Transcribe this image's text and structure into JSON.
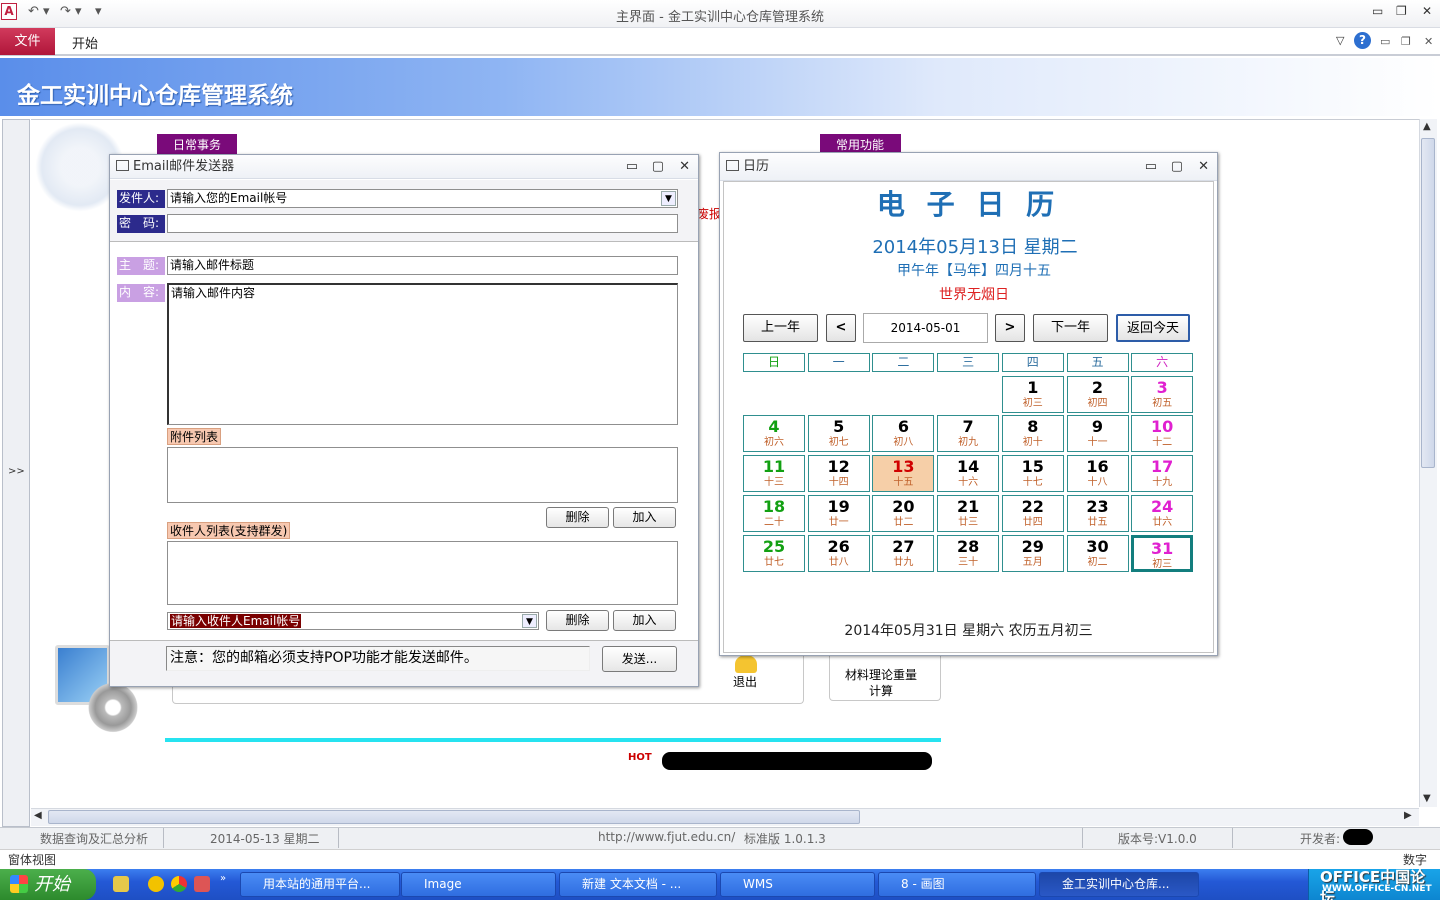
{
  "window": {
    "title": "主界面 - 金工实训中心仓库管理系统",
    "app_icon": "A"
  },
  "ribbon": {
    "file_tab": "文件",
    "home_tab": "开始"
  },
  "header": {
    "title": "金工实训中心仓库管理系统"
  },
  "nav": {
    "toggle": ">>"
  },
  "background_form": {
    "tab_daily": "日常事务",
    "tab_common": "常用功能",
    "partial_text": "废报",
    "exit_label": "退出",
    "material_label_1": "材料理论重量",
    "material_label_2": "计算",
    "hot_badge": "HOT"
  },
  "email": {
    "title": "Email邮件发送器",
    "sender_label": "发件人:",
    "sender_value": "请输入您的Email帐号",
    "password_label": "密　码:",
    "subject_label": "主　题:",
    "subject_value": "请输入邮件标题",
    "content_label": "内　容:",
    "content_value": "请输入邮件内容",
    "attachments_label": "附件列表",
    "delete_label": "删除",
    "add_label": "加入",
    "recipients_label": "收件人列表(支持群发)",
    "recipient_input": "请输入收件人Email帐号",
    "note": "注意：您的邮箱必须支持POP功能才能发送邮件。",
    "send_label": "发送..."
  },
  "calendar": {
    "title": "日历",
    "heading": "电 子 日 历",
    "date_full": "2014年05月13日  星期二",
    "lunar": "甲午年【马年】四月十五",
    "festival": "世界无烟日",
    "prev_year": "上一年",
    "prev_month": "<",
    "date_value": "2014-05-01",
    "next_month": ">",
    "next_year": "下一年",
    "back_today": "返回今天",
    "weekdays": [
      "日",
      "一",
      "二",
      "三",
      "四",
      "五",
      "六"
    ],
    "days": [
      {
        "d": "1",
        "l": "初三"
      },
      {
        "d": "2",
        "l": "初四"
      },
      {
        "d": "3",
        "l": "初五"
      },
      {
        "d": "4",
        "l": "初六"
      },
      {
        "d": "5",
        "l": "初七"
      },
      {
        "d": "6",
        "l": "初八"
      },
      {
        "d": "7",
        "l": "初九"
      },
      {
        "d": "8",
        "l": "初十"
      },
      {
        "d": "9",
        "l": "十一"
      },
      {
        "d": "10",
        "l": "十二"
      },
      {
        "d": "11",
        "l": "十三"
      },
      {
        "d": "12",
        "l": "十四"
      },
      {
        "d": "13",
        "l": "十五"
      },
      {
        "d": "14",
        "l": "十六"
      },
      {
        "d": "15",
        "l": "十七"
      },
      {
        "d": "16",
        "l": "十八"
      },
      {
        "d": "17",
        "l": "十九"
      },
      {
        "d": "18",
        "l": "二十"
      },
      {
        "d": "19",
        "l": "廿一"
      },
      {
        "d": "20",
        "l": "廿二"
      },
      {
        "d": "21",
        "l": "廿三"
      },
      {
        "d": "22",
        "l": "廿四"
      },
      {
        "d": "23",
        "l": "廿五"
      },
      {
        "d": "24",
        "l": "廿六"
      },
      {
        "d": "25",
        "l": "廿七"
      },
      {
        "d": "26",
        "l": "廿八"
      },
      {
        "d": "27",
        "l": "廿九"
      },
      {
        "d": "28",
        "l": "三十"
      },
      {
        "d": "29",
        "l": "五月"
      },
      {
        "d": "30",
        "l": "初二"
      },
      {
        "d": "31",
        "l": "初三"
      }
    ],
    "first_weekday_index": 4,
    "today_day": "13",
    "selected_day": "31",
    "footer": "2014年05月31日 星期六 农历五月初三"
  },
  "status": {
    "item1": "数据查询及汇总分析",
    "item2": "2014-05-13 星期二",
    "url": "http://www.fjut.edu.cn/",
    "edition": "标准版 1.0.1.3",
    "version": "版本号:V1.0.0",
    "developer": "开发者:",
    "view": "窗体视图",
    "numlock": "数字"
  },
  "taskbar": {
    "start": "开始",
    "items": [
      "用本站的通用平台...",
      "Image",
      "新建 文本文档 - ...",
      "WMS",
      "8 - 画图",
      "金工实训中心仓库..."
    ],
    "watermark": "OFFICE中国论坛",
    "watermark_url": "WWW.OFFICE-CN.NET"
  },
  "colors": {
    "accent": "#b0163a",
    "calendar_blue": "#1f6fb5",
    "grid": "#2f8f8f"
  }
}
